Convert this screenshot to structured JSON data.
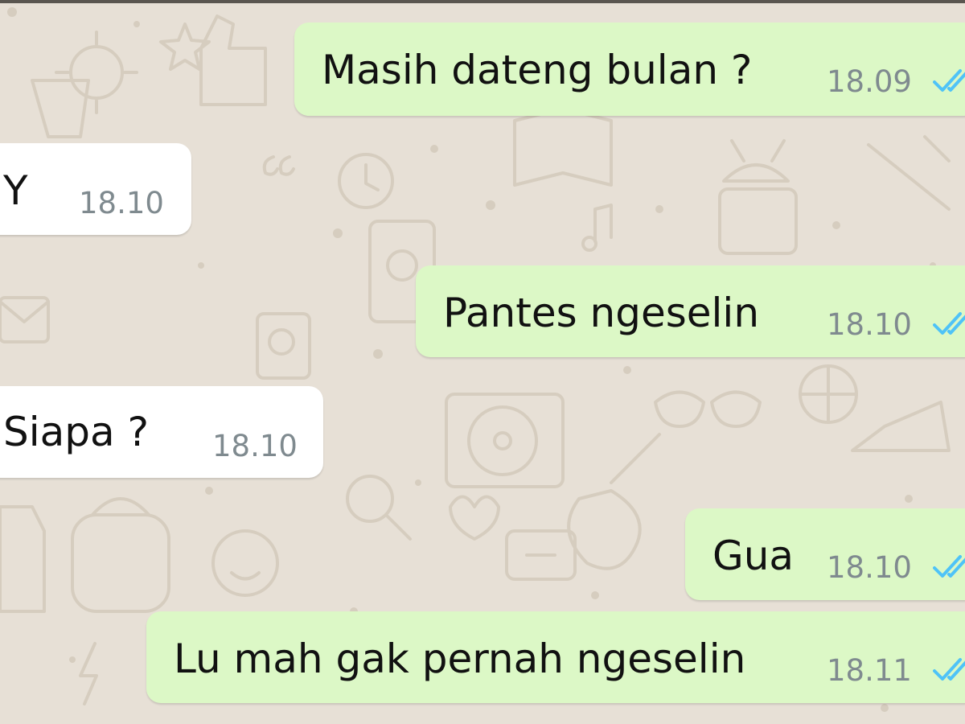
{
  "chat": {
    "messages": [
      {
        "direction": "outgoing",
        "text": "Masih dateng bulan ?",
        "time": "18.09",
        "status_icon": "double-check-icon"
      },
      {
        "direction": "incoming",
        "text": "Y",
        "time": "18.10"
      },
      {
        "direction": "outgoing",
        "text": "Pantes ngeselin",
        "time": "18.10",
        "status_icon": "double-check-icon"
      },
      {
        "direction": "incoming",
        "text": "Siapa ?",
        "time": "18.10"
      },
      {
        "direction": "outgoing",
        "text": "Gua",
        "time": "18.10",
        "status_icon": "double-check-icon"
      },
      {
        "direction": "outgoing",
        "text": "Lu mah gak pernah ngeselin",
        "time": "18.11",
        "status_icon": "double-check-icon"
      }
    ]
  },
  "colors": {
    "outgoing_bubble": "#dcf8c6",
    "incoming_bubble": "#ffffff",
    "background": "#e7e0d6",
    "read_check": "#4fc3f7",
    "time_text": "#7f8a8f"
  }
}
